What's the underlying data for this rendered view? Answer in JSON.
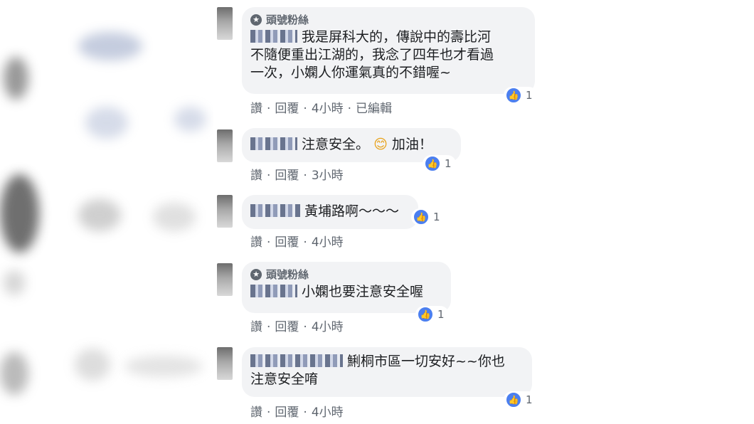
{
  "badge_label": "頭號粉絲",
  "actions": {
    "like": "讚",
    "reply": "回覆",
    "edited": "已編輯"
  },
  "comments": [
    {
      "fan": true,
      "text_line1": "我是屏科大的，傳說中的壽比河",
      "text_line2": "不隨便重出江湖的，我念了四年也才看過",
      "text_line3": "一次，小嫻人你運氣真的不錯喔~",
      "likes": "1",
      "time": "4小時"
    },
    {
      "fan": false,
      "text": "注意安全。",
      "text_after": "加油！",
      "emoji": "😊",
      "likes": "1",
      "time": "3小時"
    },
    {
      "fan": false,
      "text": "黃埔路啊～～～",
      "likes": "1",
      "time": "4小時"
    },
    {
      "fan": true,
      "text": "小嫻也要注意安全喔",
      "likes": "1",
      "time": "4小時"
    },
    {
      "fan": false,
      "text_line1": "鯏桐市區一切安好~~你也",
      "text_line2": "注意安全唷",
      "likes": "1",
      "time": "4小時"
    }
  ]
}
